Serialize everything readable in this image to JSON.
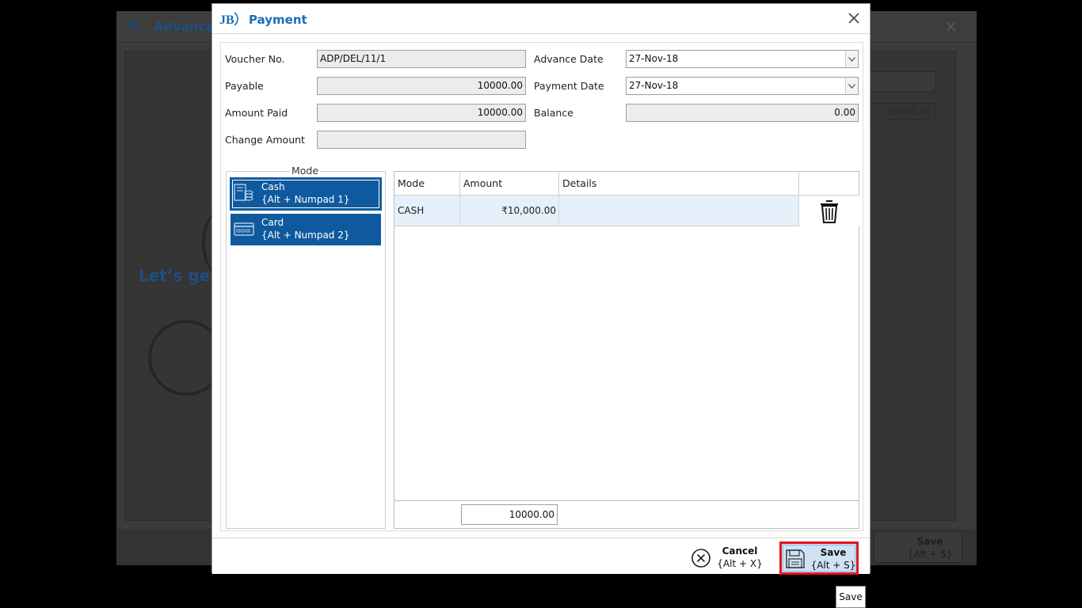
{
  "background": {
    "logo": "JB",
    "title": "Advance",
    "headline": "Let’s get s",
    "field_value": "10000.00",
    "save_label": "Save",
    "save_shortcut": "{Alt + S}"
  },
  "dialog": {
    "logo": "JB",
    "title": "Payment",
    "fields": {
      "voucher_label": "Voucher No.",
      "voucher_value": "ADP/DEL/11/1",
      "payable_label": "Payable",
      "payable_value": "10000.00",
      "amount_paid_label": "Amount Paid",
      "amount_paid_value": "10000.00",
      "change_amount_label": "Change Amount",
      "change_amount_value": "",
      "advance_date_label": "Advance Date",
      "advance_date_value": "27-Nov-18",
      "payment_date_label": "Payment Date",
      "payment_date_value": "27-Nov-18",
      "balance_label": "Balance",
      "balance_value": "0.00"
    },
    "mode_group": {
      "legend": "Mode",
      "buttons": [
        {
          "label": "Cash",
          "shortcut": "{Alt + Numpad 1}",
          "icon": "cash-icon"
        },
        {
          "label": "Card",
          "shortcut": "{Alt + Numpad 2}",
          "icon": "card-icon"
        }
      ]
    },
    "grid": {
      "columns": [
        "Mode",
        "Amount",
        "Details"
      ],
      "rows": [
        {
          "mode": "CASH",
          "amount": "₹10,000.00",
          "details": ""
        }
      ],
      "total": "10000.00"
    },
    "actions": {
      "cancel_label": "Cancel",
      "cancel_shortcut": "{Alt + X}",
      "save_label": "Save",
      "save_shortcut": "{Alt + S}"
    },
    "colors": {
      "accent": "#1a6fb5",
      "mode_button": "#0f5a9e",
      "highlight": "#e0141e",
      "row_selected": "#e6f0fa"
    }
  },
  "tooltip": "Save"
}
